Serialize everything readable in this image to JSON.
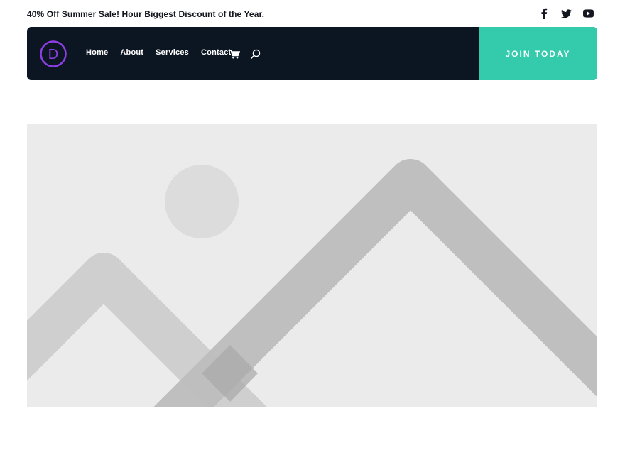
{
  "topbar": {
    "promo_text": "40% Off Summer Sale! Hour Biggest Discount of the Year.",
    "social": [
      "facebook-icon",
      "twitter-icon",
      "youtube-icon"
    ]
  },
  "nav": {
    "logo_letter": "D",
    "items": [
      {
        "label": "Home"
      },
      {
        "label": "About"
      },
      {
        "label": "Services"
      },
      {
        "label": "Contact"
      }
    ],
    "icons": [
      "cart-icon",
      "search-icon"
    ],
    "cta_label": "JOIN TODAY"
  },
  "colors": {
    "nav_bg": "#0b1622",
    "cta_bg": "#33cbac",
    "logo_accent": "#8e3ee6",
    "placeholder_bg": "#ebebeb"
  },
  "hero": {
    "image": "image-placeholder"
  }
}
